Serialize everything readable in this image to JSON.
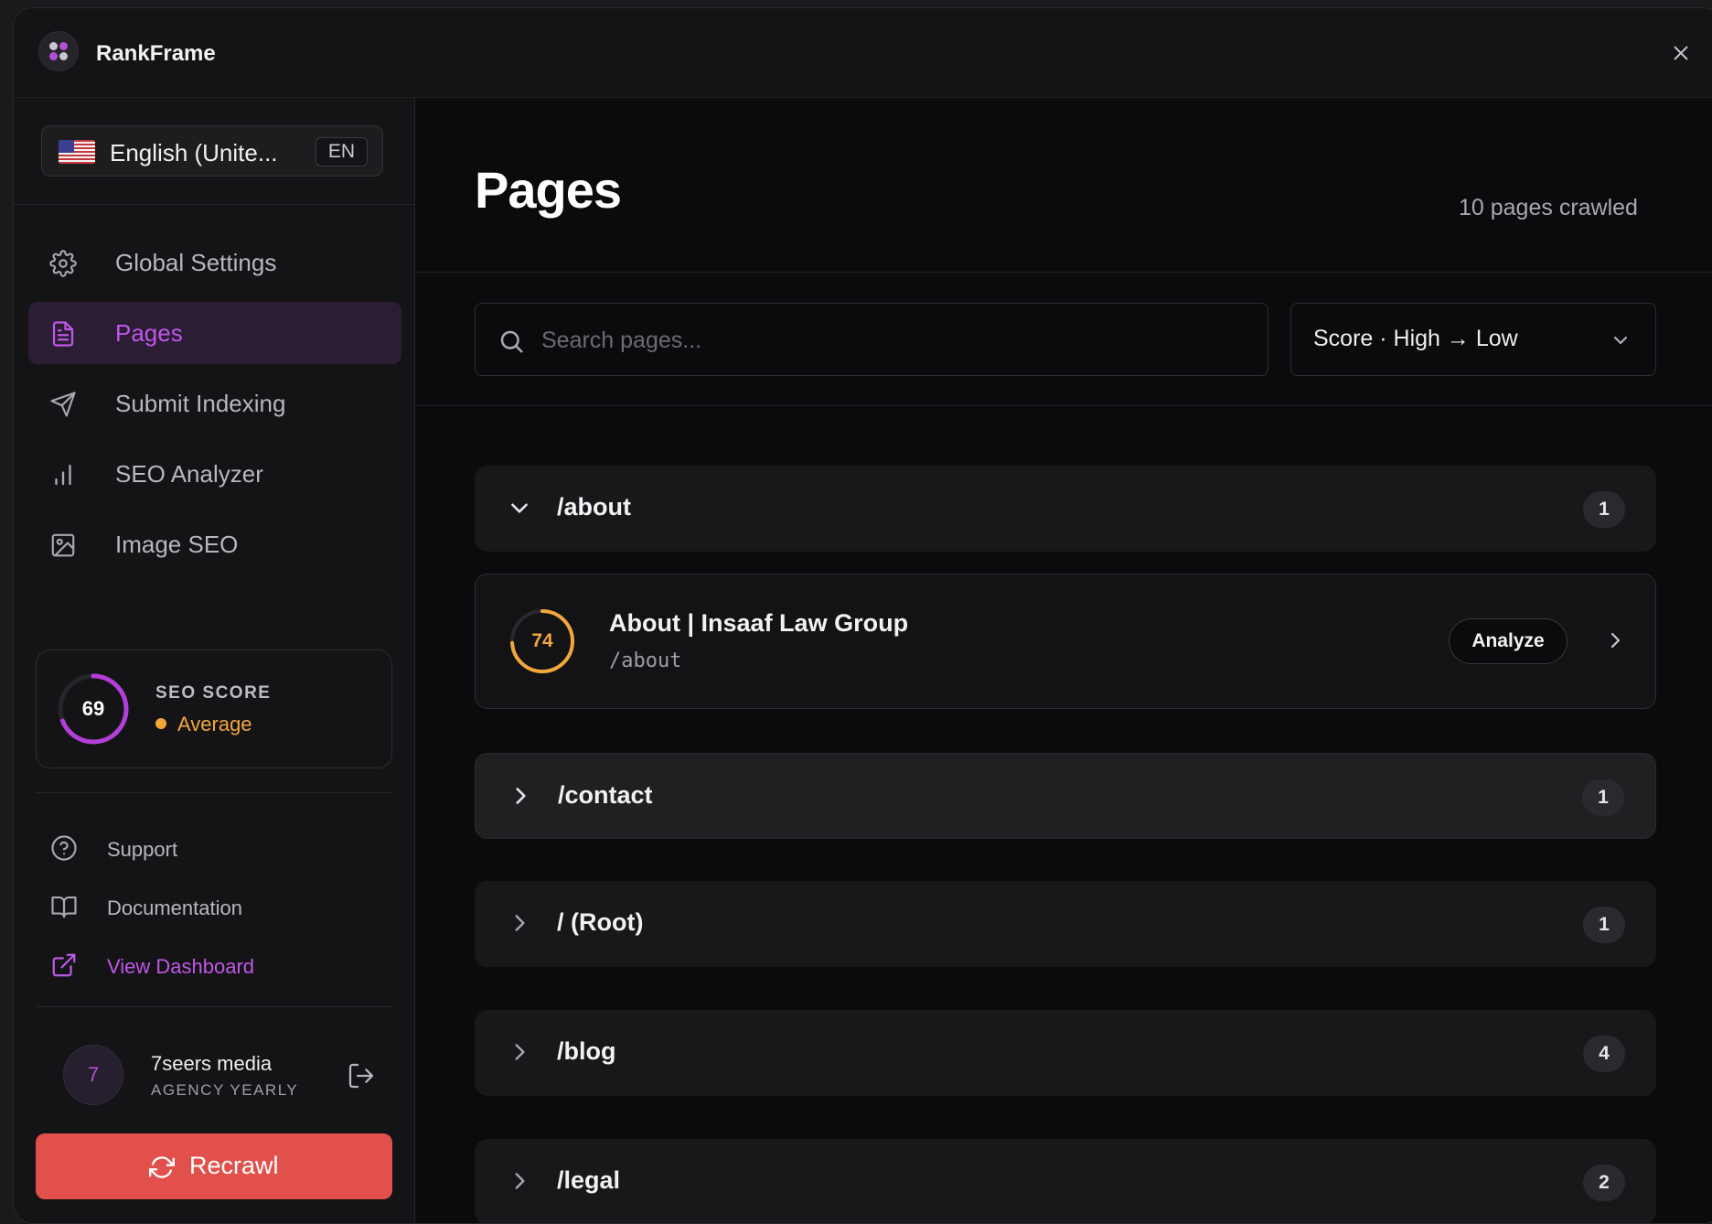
{
  "app": {
    "title": "RankFrame",
    "close_icon": "close-icon"
  },
  "language": {
    "label": "English (Unite...",
    "code": "EN",
    "flag": "us-flag-icon"
  },
  "nav": {
    "items": [
      {
        "label": "Global Settings",
        "icon": "gear-icon",
        "active": false
      },
      {
        "label": "Pages",
        "icon": "document-icon",
        "active": true
      },
      {
        "label": "Submit Indexing",
        "icon": "send-icon",
        "active": false
      },
      {
        "label": "SEO Analyzer",
        "icon": "bar-chart-icon",
        "active": false
      },
      {
        "label": "Image SEO",
        "icon": "image-icon",
        "active": false
      }
    ]
  },
  "seo_score": {
    "value": 69,
    "max": 100,
    "caption": "SEO SCORE",
    "status": "Average",
    "ring_color": "#b43ed8",
    "status_color": "#f3a73b"
  },
  "links": [
    {
      "label": "Support",
      "icon": "help-circle-icon"
    },
    {
      "label": "Documentation",
      "icon": "book-icon"
    },
    {
      "label": "View Dashboard",
      "icon": "external-link-icon"
    }
  ],
  "account": {
    "initial": "7",
    "name": "7seers media",
    "plan": "AGENCY YEARLY"
  },
  "recrawl": {
    "label": "Recrawl",
    "color": "#e2504c"
  },
  "main": {
    "title": "Pages",
    "count_text": "10 pages crawled",
    "search": {
      "placeholder": "Search pages...",
      "value": ""
    },
    "sort": {
      "label": "Score · High → Low"
    }
  },
  "groups": [
    {
      "path": "/about",
      "count": "1",
      "expanded": true
    },
    {
      "path": "/contact",
      "count": "1",
      "expanded": false
    },
    {
      "path": "/ (Root)",
      "count": "1",
      "expanded": false
    },
    {
      "path": "/blog",
      "count": "4",
      "expanded": false
    },
    {
      "path": "/legal",
      "count": "2",
      "expanded": false
    }
  ],
  "about_page": {
    "score": 74,
    "max": 100,
    "title": "About | Insaaf Law Group",
    "path": "/about",
    "action": "Analyze",
    "ring_color": "#f3a73b"
  }
}
